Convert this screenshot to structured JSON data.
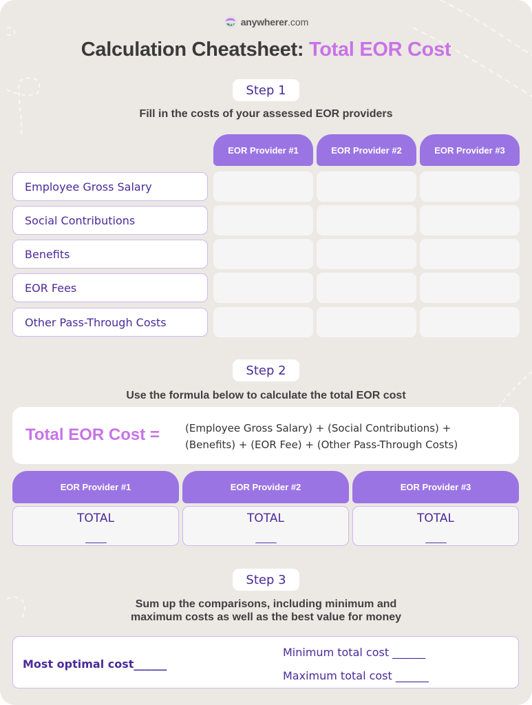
{
  "brand": {
    "logo_bold": "anywherer",
    "logo_suffix": ".com"
  },
  "title": {
    "main": "Calculation Cheatsheet: ",
    "accent": "Total EOR Cost"
  },
  "step1": {
    "badge": "Step 1",
    "description": "Fill in the costs of your assessed EOR providers",
    "providers": [
      "EOR Provider  #1",
      "EOR Provider  #2",
      "EOR Provider  #3"
    ],
    "rows": [
      "Employee Gross Salary",
      "Social Contributions",
      "Benefits",
      "EOR Fees",
      "Other Pass-Through Costs"
    ]
  },
  "step2": {
    "badge": "Step 2",
    "description": "Use the formula below to calculate the total EOR cost",
    "formula_lhs": "Total EOR Cost =",
    "formula_rhs_line1": "(Employee Gross Salary) + (Social Contributions) +",
    "formula_rhs_line2": "(Benefits) + (EOR Fee) + (Other Pass-Through Costs)",
    "providers": [
      "EOR Provider  #1",
      "EOR Provider  #2",
      "EOR Provider  #3"
    ],
    "total_label": "TOTAL",
    "total_blank": "____"
  },
  "step3": {
    "badge": "Step 3",
    "description_line1": "Sum up the comparisons, including minimum and",
    "description_line2": "maximum costs as well as the best value for money",
    "optimal": "Most optimal cost______",
    "minimum": "Minimum total cost ______",
    "maximum": "Maximum total cost ______"
  },
  "colors": {
    "accent_pink": "#c873e6",
    "purple": "#9b74e3",
    "dark_purple": "#4b2a99",
    "background": "#ece8e4"
  }
}
